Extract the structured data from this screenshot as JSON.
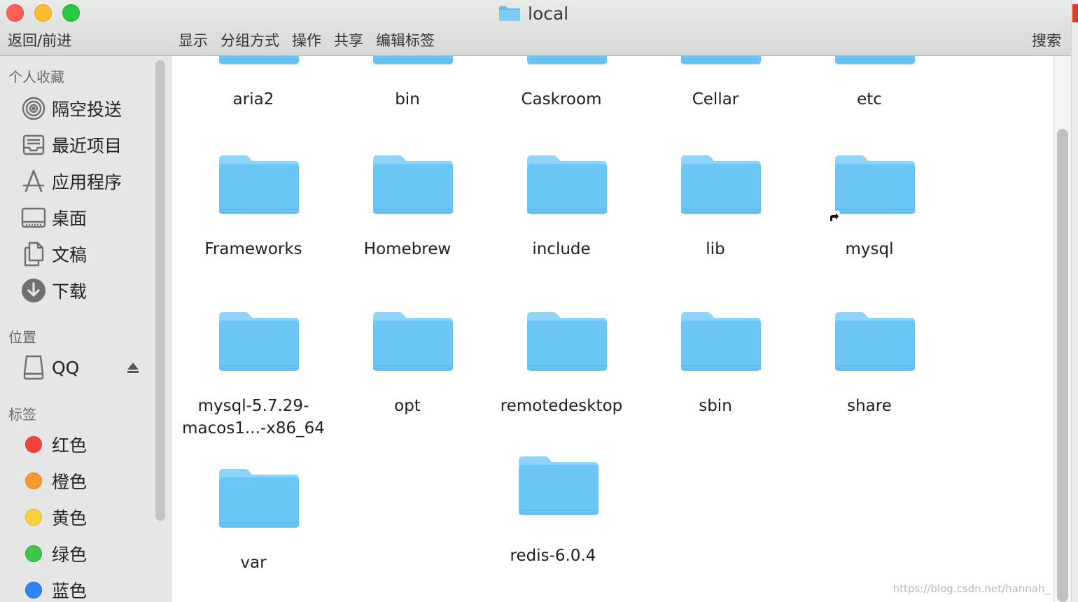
{
  "window": {
    "title": "local"
  },
  "toolbar": {
    "nav": "返回/前进",
    "menu": [
      "显示",
      "分组方式",
      "操作",
      "共享",
      "编辑标签"
    ],
    "search": "搜索"
  },
  "sidebar": {
    "favorites_header": "个人收藏",
    "favorites": [
      {
        "label": "隔空投送",
        "icon": "airdrop-icon"
      },
      {
        "label": "最近项目",
        "icon": "recents-icon"
      },
      {
        "label": "应用程序",
        "icon": "applications-icon"
      },
      {
        "label": "桌面",
        "icon": "desktop-icon"
      },
      {
        "label": "文稿",
        "icon": "documents-icon"
      },
      {
        "label": "下载",
        "icon": "downloads-icon"
      }
    ],
    "locations_header": "位置",
    "locations": [
      {
        "label": "QQ",
        "icon": "disk-icon"
      }
    ],
    "tags_header": "标签",
    "tags": [
      {
        "label": "红色",
        "color": "#f2423c"
      },
      {
        "label": "橙色",
        "color": "#f7992f"
      },
      {
        "label": "黄色",
        "color": "#fad13c"
      },
      {
        "label": "绿色",
        "color": "#3cc54d"
      },
      {
        "label": "蓝色",
        "color": "#2f85f5"
      }
    ]
  },
  "folders": [
    {
      "name": "aria2"
    },
    {
      "name": "bin"
    },
    {
      "name": "Caskroom"
    },
    {
      "name": "Cellar"
    },
    {
      "name": "etc"
    },
    {
      "name": "Frameworks"
    },
    {
      "name": "Homebrew"
    },
    {
      "name": "include"
    },
    {
      "name": "lib"
    },
    {
      "name": "mysql",
      "alias": true
    },
    {
      "name": "mysql-5.7.29-",
      "name2": "macos1...-x86_64"
    },
    {
      "name": "opt"
    },
    {
      "name": "remotedesktop"
    },
    {
      "name": "sbin"
    },
    {
      "name": "share"
    },
    {
      "name": "var"
    },
    {
      "name": "redis-6.0.4"
    }
  ],
  "colors": {
    "folder": "#6ac6f5",
    "folder_tab": "#8fd4f8"
  },
  "watermark": "https://blog.csdn.net/hannah_"
}
